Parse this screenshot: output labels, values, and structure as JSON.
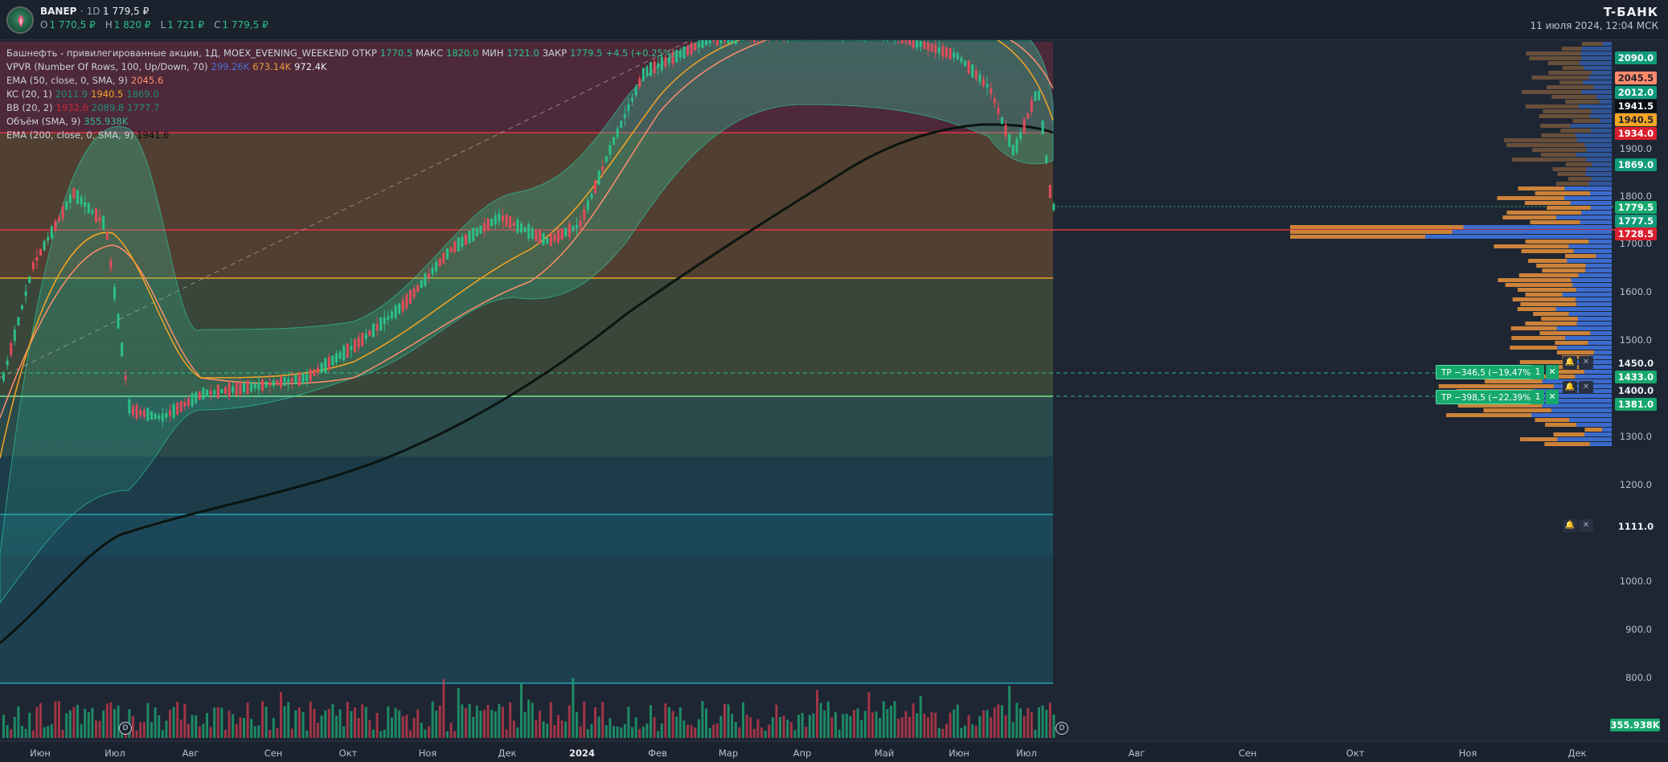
{
  "header": {
    "symbol": "BANEP",
    "timeframe": "· 1D ·",
    "last_price": "1 779,5 ₽",
    "ohlc": [
      {
        "k": "O",
        "v": "1 770,5 ₽"
      },
      {
        "k": "H",
        "v": "1 820 ₽"
      },
      {
        "k": "L",
        "v": "1 721 ₽"
      },
      {
        "k": "C",
        "v": "1 779,5 ₽"
      }
    ],
    "brand": "T-БАНК",
    "datetime": "11 июля 2024, 12:04 МСК"
  },
  "legend": [
    {
      "label": "Башнефть - привилегированные акции, 1Д, MOEX_EVENING_WEEKEND",
      "values": [
        {
          "t": "ОТКР",
          "c": "#c9d1dc"
        },
        {
          "t": "1770.5",
          "c": "#2cc08a"
        },
        {
          "t": "МАКС",
          "c": "#c9d1dc"
        },
        {
          "t": "1820.0",
          "c": "#2cc08a"
        },
        {
          "t": "МИН",
          "c": "#c9d1dc"
        },
        {
          "t": "1721.0",
          "c": "#2cc08a"
        },
        {
          "t": "ЗАКР",
          "c": "#c9d1dc"
        },
        {
          "t": "1779.5",
          "c": "#2cc08a"
        },
        {
          "t": "+4.5 (+0.25%)",
          "c": "#2cc08a"
        }
      ]
    },
    {
      "label": "VPVR (Number Of Rows, 100, Up/Down, 70)",
      "values": [
        {
          "t": "299.26K",
          "c": "#4c6fd6"
        },
        {
          "t": "673.14K",
          "c": "#e89a3c"
        },
        {
          "t": "972.4K",
          "c": "#e8edf3"
        }
      ]
    },
    {
      "label": "EMA (50, close, 0, SMA, 9)",
      "values": [
        {
          "t": "2045.6",
          "c": "#ff8f6b"
        }
      ]
    },
    {
      "label": "KC (20, 1)",
      "values": [
        {
          "t": "2011.9",
          "c": "#1f8f7a"
        },
        {
          "t": "1940.5",
          "c": "#f6a524"
        },
        {
          "t": "1869.0",
          "c": "#1f8f7a"
        }
      ]
    },
    {
      "label": "BB (20, 2)",
      "values": [
        {
          "t": "1932.6",
          "c": "#c6283a"
        },
        {
          "t": "2089.8",
          "c": "#1f8f7a"
        },
        {
          "t": "1777.7",
          "c": "#1f8f7a"
        }
      ]
    },
    {
      "label": "Объём (SMA, 9)",
      "values": [
        {
          "t": "355.938K",
          "c": "#2cc08a"
        }
      ]
    },
    {
      "label": "EMA (200, close, 0, SMA, 9)",
      "values": [
        {
          "t": "1941.6",
          "c": "#0b0f14"
        }
      ]
    }
  ],
  "price_axis": [
    "1900.0",
    "1800.0",
    "1700.0",
    "1600.0",
    "1500.0",
    "1300.0",
    "1200.0",
    "1000.0",
    "900.0",
    "800.0"
  ],
  "price_tags": [
    {
      "text": "2090.0",
      "bg": "#0f9b7a",
      "fg": "#ffffff"
    },
    {
      "text": "2045.5",
      "bg": "#ff8a6b",
      "fg": "#1b222d"
    },
    {
      "text": "2012.0",
      "bg": "#0f9b7a",
      "fg": "#ffffff"
    },
    {
      "text": "1941.5",
      "bg": "#0b0f14",
      "fg": "#ffffff"
    },
    {
      "text": "1940.5",
      "bg": "#f6a524",
      "fg": "#1b222d"
    },
    {
      "text": "1934.0",
      "bg": "#d8202e",
      "fg": "#ffffff"
    },
    {
      "text": "1869.0",
      "bg": "#0f9b7a",
      "fg": "#ffffff"
    },
    {
      "text": "1779.5",
      "bg": "#16a86d",
      "fg": "#ffffff"
    },
    {
      "text": "1777.5",
      "bg": "#0f9b7a",
      "fg": "#ffffff"
    },
    {
      "text": "1728.5",
      "bg": "#d8202e",
      "fg": "#ffffff"
    },
    {
      "text": "1450.0",
      "bg": "#1e2633",
      "fg": "#e8edf3"
    },
    {
      "text": "1433.0",
      "bg": "#16a86d",
      "fg": "#ffffff"
    },
    {
      "text": "1400.0",
      "bg": "#1e2633",
      "fg": "#e8edf3"
    },
    {
      "text": "1381.0",
      "bg": "#16a86d",
      "fg": "#ffffff"
    },
    {
      "text": "1111.0",
      "bg": "#1e2633",
      "fg": "#e8edf3"
    },
    {
      "text": "355.938K",
      "bg": "#16a86d",
      "fg": "#ffffff"
    }
  ],
  "orders": [
    {
      "label": "TP −346,5 (−19,47%)",
      "qty": "1"
    },
    {
      "label": "TP −398,5 (−22,39%)",
      "qty": "1"
    }
  ],
  "date_axis": [
    "Июн",
    "Июл",
    "Авг",
    "Сен",
    "Окт",
    "Ноя",
    "Дек",
    "2024",
    "Фев",
    "Мар",
    "Апр",
    "Май",
    "Июн",
    "Июл",
    "Авг",
    "Сен",
    "Окт",
    "Ноя",
    "Дек"
  ],
  "event_marker": "D",
  "icons": {
    "bell": "alert-bell-icon",
    "close": "close-icon",
    "logo": "bashneft-logo-icon"
  }
}
